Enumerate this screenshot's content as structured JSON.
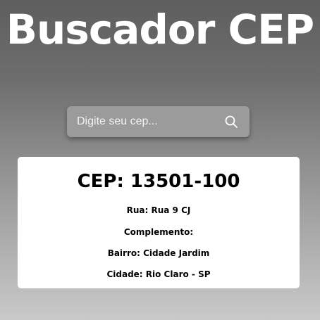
{
  "header": {
    "title": "Buscador CEP"
  },
  "search": {
    "placeholder": "Digite seu cep...",
    "value": "",
    "button_icon": "search-icon"
  },
  "result": {
    "cep": "CEP: 13501-100",
    "rua": "Rua: Rua 9 CJ",
    "complemento": "Complemento:",
    "bairro": "Bairro: Cidade Jardim",
    "cidade": "Cidade: Rio Claro - SP"
  },
  "colors": {
    "background_top": "#5e5e5e",
    "background_bottom": "#c9c9c9",
    "search_box": "#9b9b9b",
    "card": "#ffffff",
    "title": "#ffffff"
  }
}
